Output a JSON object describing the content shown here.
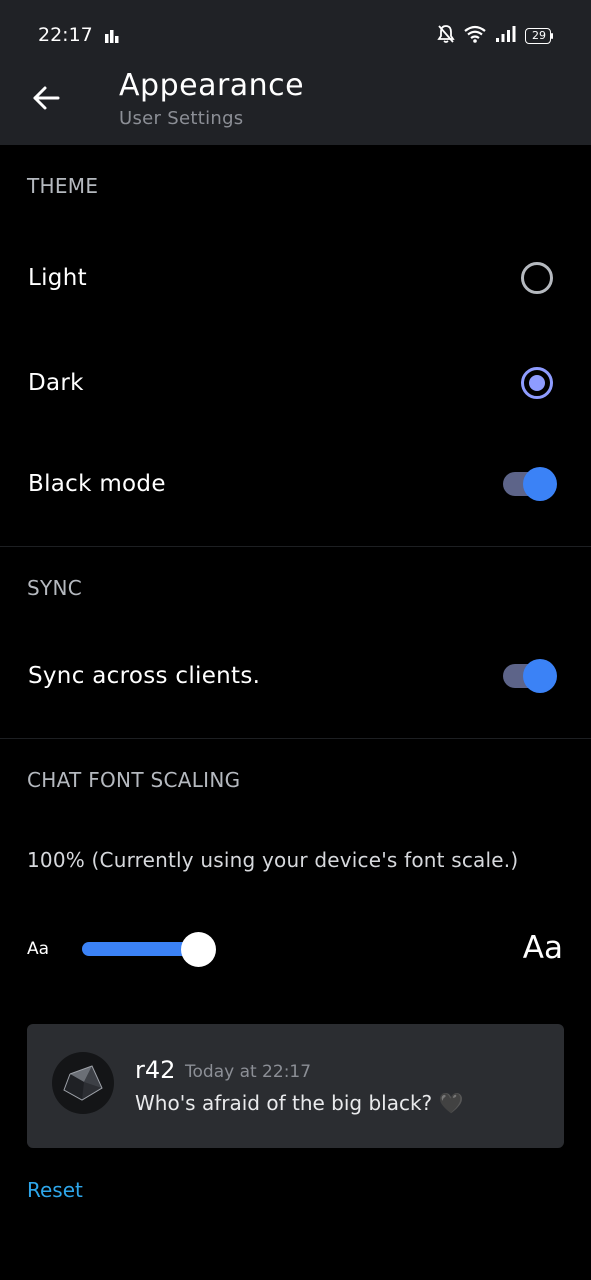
{
  "status_bar": {
    "time": "22:17",
    "battery_level": "29",
    "icons": [
      "activity-icon",
      "notifications-off-icon",
      "wifi-icon",
      "signal-icon",
      "battery-icon"
    ]
  },
  "header": {
    "title": "Appearance",
    "subtitle": "User Settings",
    "back_icon": "arrow-left-icon"
  },
  "theme": {
    "section_label": "THEME",
    "options": [
      {
        "label": "Light",
        "selected": false
      },
      {
        "label": "Dark",
        "selected": true
      }
    ],
    "black_mode": {
      "label": "Black mode",
      "enabled": true
    }
  },
  "sync": {
    "section_label": "SYNC",
    "toggle": {
      "label": "Sync across clients.",
      "enabled": true
    }
  },
  "font_scaling": {
    "section_label": "CHAT FONT SCALING",
    "description": "100% (Currently using your device's font scale.)",
    "small_label": "Aa",
    "large_label": "Aa"
  },
  "preview": {
    "username": "r42",
    "timestamp": "Today at 22:17",
    "message": "Who's afraid of the big black? 🖤"
  },
  "reset_label": "Reset",
  "colors": {
    "accent_blue": "#3b82f6",
    "radio_purple": "#8e9cff",
    "link_blue": "#2ea6ea",
    "header_bg": "#202226",
    "card_bg": "#2b2d31"
  }
}
